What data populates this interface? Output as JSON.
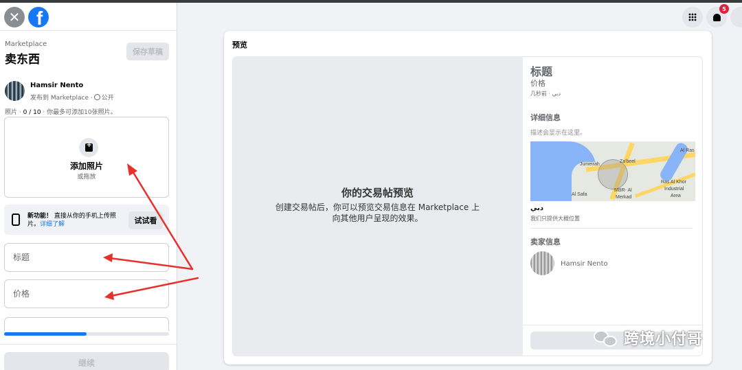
{
  "sidebar": {
    "breadcrumb": "Marketplace",
    "title": "卖东西",
    "save_draft": "保存草稿",
    "user_name": "Hamsir Nento",
    "post_target": "发布到 Marketplace ·",
    "visibility": "公开",
    "photos_label": "照片 ·",
    "photos_count": "0 / 10",
    "photos_hint": " · 你最多可添加10张照片。",
    "add_photo": "添加照片",
    "drag_hint": "或拖放",
    "feature_prefix": "新功能！",
    "feature_text": " 直接从你的手机上传照片。",
    "feature_link": "详细了解",
    "try_button": "试试看",
    "title_placeholder": "标题",
    "price_placeholder": "价格",
    "progress": 0.5,
    "next_button": "继续"
  },
  "topbar": {
    "notification_count": "5"
  },
  "preview": {
    "heading": "预览",
    "main_title": "你的交易帖预览",
    "main_desc": "创建交易帖后，你可以预览交易信息在 Marketplace 上向其他用户呈现的效果。",
    "side_title": "标题",
    "side_price": "价格",
    "side_time": "几秒前 · دبي",
    "details_heading": "详细信息",
    "details_placeholder": "描述会显示在这里。",
    "map_labels": [
      "Jumeirah",
      "Za'beel",
      "Al Ras",
      "Ras Al Khor",
      "Industrial",
      "Area",
      "MBR- Al",
      "Merkad",
      "Al Safa"
    ],
    "city": "دبي",
    "approx_location": "我们只提供大概位置",
    "seller_heading": "卖家信息",
    "seller_name": "Hamsir Nento"
  },
  "watermark": {
    "text": "跨境小付哥"
  },
  "colors": {
    "brand": "#1877f2",
    "badge": "#e41e3f",
    "arrow": "#e8302a"
  }
}
